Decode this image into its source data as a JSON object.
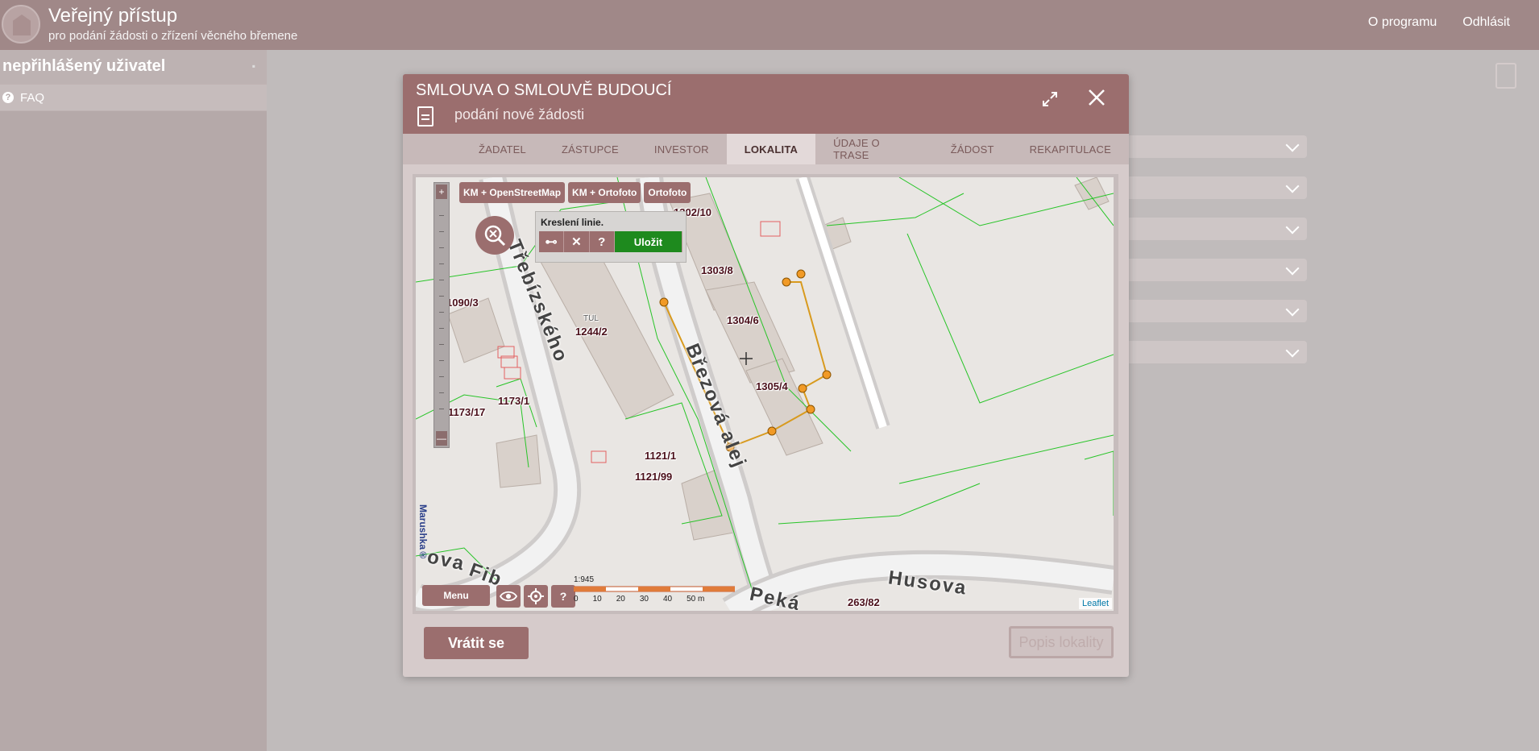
{
  "header": {
    "title": "Veřejný přístup",
    "subtitle": "pro podání žádosti o zřízení věcného břemene",
    "links": [
      "O programu",
      "Odhlásit"
    ]
  },
  "sidebar": {
    "user": "nepřihlášený uživatel",
    "items": [
      {
        "label": "FAQ",
        "icon": "question-circle-icon"
      }
    ]
  },
  "modal": {
    "title": "SMLOUVA O SMLOUVĚ BUDOUCÍ",
    "subtitle": "podání nové žádosti",
    "tabs": [
      "ŽADATEL",
      "ZÁSTUPCE",
      "INVESTOR",
      "LOKALITA",
      "ÚDAJE O TRASE",
      "ŽÁDOST",
      "REKAPITULACE"
    ],
    "active_tab": "LOKALITA",
    "back_button": "Vrátit se",
    "describe_button": "Popis lokality"
  },
  "map": {
    "layers": [
      "KM + OpenStreetMap",
      "KM + Ortofoto",
      "Ortofoto"
    ],
    "draw": {
      "title": "Kreslení linie.",
      "tools": [
        "⊷",
        "✕",
        "?"
      ],
      "save": "Uložit"
    },
    "menu": "Menu",
    "help": "?",
    "zoom_in": "+",
    "zoom_out": "—",
    "scale_ratio": "1:945",
    "scale_ticks": [
      "0",
      "10",
      "20",
      "30",
      "40",
      "50 m"
    ],
    "attribution": "Leaflet",
    "watermark": "Marushka®",
    "parcels": [
      "1302/10",
      "1303/8",
      "1304/6",
      "1305/4",
      "1090/3",
      "1244/2",
      "1173/1",
      "1173/17",
      "1121/1",
      "1121/99",
      "263/82",
      "TUL"
    ],
    "streets": [
      "Třebízského",
      "Březová alej",
      "Husova",
      "Peká",
      "Fib",
      "ova"
    ]
  }
}
